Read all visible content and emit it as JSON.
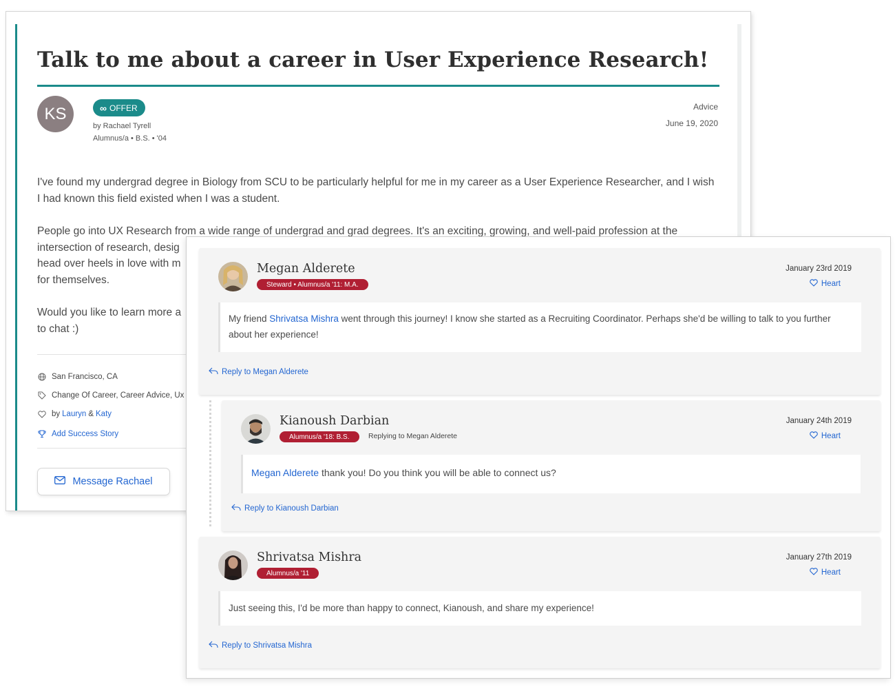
{
  "post": {
    "title": "Talk to me about a career in User Experience Research!",
    "avatar_initials": "KS",
    "offer_label": "OFFER",
    "author": "by Rachael Tyrell",
    "author_meta": "Alumnus/a • B.S. • '04",
    "category": "Advice",
    "date": "June 19, 2020",
    "body": [
      "I've found my undergrad degree in Biology from SCU to be particularly helpful for me in my career as a User Experience Researcher, and I wish I had known this field existed when I was a student.",
      "People go into UX Research from a wide range of undergrad and grad degrees. It's an exciting, growing, and well-paid profession at the intersection of research, desig",
      "head over heels in love with m",
      "for themselves.",
      "Would you like to learn more a",
      "to chat :)"
    ],
    "location": "San Francisco, CA",
    "tags": "Change Of Career, Career Advice, Ux",
    "likes_prefix": "by",
    "liker_1": "Lauryn",
    "likes_joiner": "&",
    "liker_2": "Katy",
    "add_success_story": "Add Success Story",
    "message_button": "Message Rachael"
  },
  "comments": [
    {
      "name": "Megan Alderete",
      "badge": "Steward • Alumnus/a '11: M.A.",
      "date": "January 23rd 2019",
      "heart": "Heart",
      "body_prefix": "My friend",
      "body_link": "Shrivatsa Mishra",
      "body_suffix": "went through this journey! I know she started as a Recruiting Coordinator.  Perhaps she'd be willing to talk to you further about her experience!",
      "reply": "Reply to Megan Alderete"
    },
    {
      "name": "Kianoush Darbian",
      "badge": "Alumnus/a '18: B.S.",
      "replying_to": "Replying to Megan Alderete",
      "date": "January 24th 2019",
      "heart": "Heart",
      "body_link": "Megan Alderete",
      "body_suffix": "thank you! Do you think you will be able to connect us?",
      "reply": "Reply to Kianoush Darbian"
    },
    {
      "name": "Shrivatsa Mishra",
      "badge": "Alumnus/a '11",
      "date": "January 27th 2019",
      "heart": "Heart",
      "body": "Just seeing this, I'd be more than happy to connect, Kianoush, and share my experience!",
      "reply": "Reply to Shrivatsa Mishra"
    }
  ],
  "colors": {
    "teal_accent": "#1b8b8a",
    "badge_red": "#b01f33",
    "link_blue": "#2366d1",
    "initials_avatar": "#8b7f81"
  },
  "icons": [
    "infinity-icon",
    "globe-icon",
    "tag-icon",
    "heart-icon",
    "trophy-icon",
    "envelope-icon",
    "reply-icon"
  ]
}
